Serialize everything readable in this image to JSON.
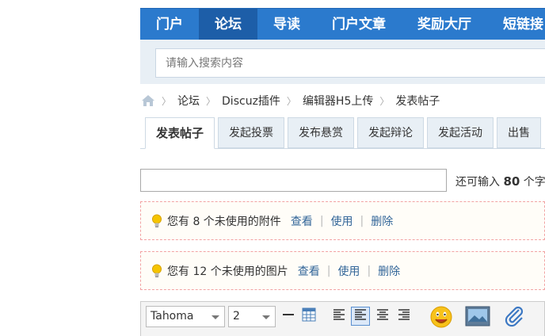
{
  "nav": {
    "items": [
      "门户",
      "论坛",
      "导读",
      "门户文章",
      "奖励大厅",
      "短链接"
    ],
    "active_index": 1
  },
  "search": {
    "placeholder": "请输入搜索内容"
  },
  "breadcrumb": {
    "items": [
      "论坛",
      "Discuz插件",
      "编辑器H5上传",
      "发表帖子"
    ]
  },
  "tabs": {
    "items": [
      "发表帖子",
      "发起投票",
      "发布悬赏",
      "发起辩论",
      "发起活动",
      "出售"
    ],
    "active_index": 0
  },
  "title_field": {
    "hint_prefix": "还可输入",
    "hint_count": "80",
    "hint_suffix": "个字符"
  },
  "notices": {
    "attachments": {
      "text": "您有 8 个未使用的附件",
      "view": "查看",
      "use": "使用",
      "delete": "删除"
    },
    "images": {
      "text": "您有 12 个未使用的图片",
      "view": "查看",
      "use": "使用",
      "delete": "删除"
    }
  },
  "editor": {
    "font_name": "Tahoma",
    "font_size": "2"
  },
  "colors": {
    "nav_bg": "#2b7acd",
    "nav_active": "#1d5ea8",
    "link": "#336699",
    "notice_border": "#f2a3a3"
  }
}
